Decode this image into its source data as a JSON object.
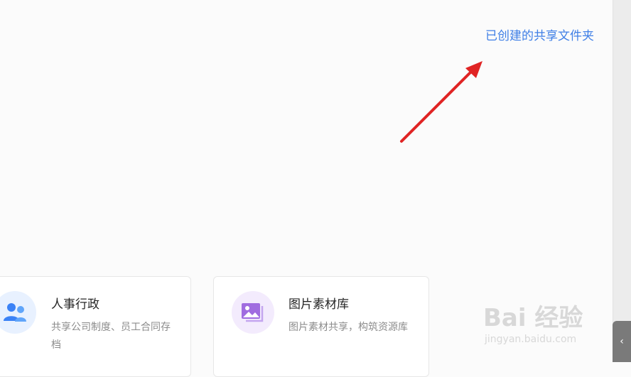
{
  "header": {
    "created_folder_link": "已创建的共享文件夹"
  },
  "cards": [
    {
      "title": "人事行政",
      "description": "共享公司制度、员工合同存档",
      "icon": "people-icon"
    },
    {
      "title": "图片素材库",
      "description": "图片素材共享，构筑资源库",
      "icon": "image-gallery-icon"
    }
  ],
  "annotation": {
    "arrow_color": "#e02424"
  },
  "watermark": {
    "main": "Bai 经验",
    "url": "jingyan.baidu.com"
  },
  "colors": {
    "link": "#3f7fe6",
    "people_icon": "#3b82f6",
    "image_icon": "#a06ce0"
  }
}
